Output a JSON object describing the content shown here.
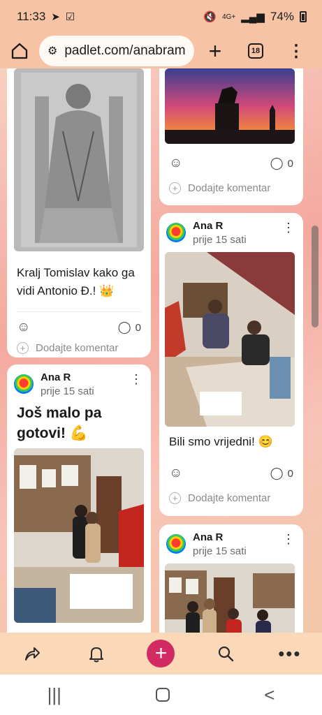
{
  "status_bar": {
    "time": "11:33",
    "battery": "74%",
    "network": "4G+"
  },
  "browser": {
    "url": "padlet.com/anabram",
    "tab_count": "18"
  },
  "posts": {
    "post1": {
      "caption_line1": "Kralj Tomislav kako ga",
      "caption_line2": "vidi Antonio Đ.! 👑",
      "comment_count": "0",
      "add_comment": "Dodajte komentar"
    },
    "post2": {
      "comment_count": "0",
      "add_comment": "Dodajte komentar"
    },
    "post3": {
      "author": "Ana R",
      "time": "prije 15 sati",
      "title_line1": "Još malo pa",
      "title_line2": "gotovi! 💪"
    },
    "post4": {
      "author": "Ana R",
      "time": "prije 15 sati",
      "caption": "Bili smo vrijedni! 😊",
      "comment_count": "0",
      "add_comment": "Dodajte komentar"
    },
    "post5": {
      "author": "Ana R",
      "time": "prije 15 sati"
    }
  },
  "bottom_nav": {
    "icons": [
      "share-icon",
      "bell-icon",
      "add-icon",
      "search-icon",
      "more-icon"
    ]
  },
  "colors": {
    "accent": "#d22a63",
    "header_bg": "#f6c3a4"
  }
}
